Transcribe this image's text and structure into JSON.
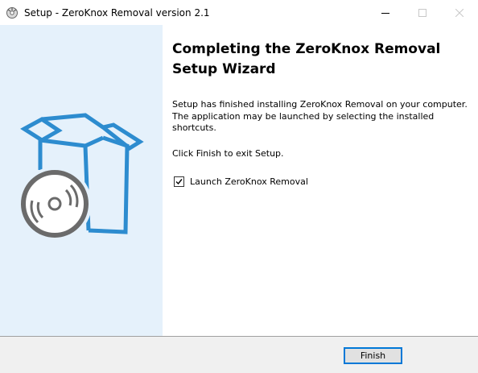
{
  "window": {
    "title": "Setup - ZeroKnox Removal version 2.1",
    "app_icon": "setup-icon",
    "controls": {
      "minimize": "minimize-icon",
      "maximize": "maximize-icon",
      "close": "close-icon"
    }
  },
  "illustration": {
    "icon": "box-with-disc-icon",
    "colors": {
      "panel_bg": "#e5f1fb",
      "box_stroke": "#2d8ccf",
      "disc_stroke": "#6b6b6b"
    }
  },
  "main": {
    "heading": "Completing the ZeroKnox Removal Setup Wizard",
    "body": "Setup has finished installing ZeroKnox Removal on your computer. The application may be launched by selecting the installed shortcuts.",
    "finish_hint": "Click Finish to exit Setup.",
    "launch_checkbox": {
      "label": "Launch ZeroKnox Removal",
      "checked": true
    }
  },
  "footer": {
    "finish_label": "Finish",
    "accent": "#0078d7"
  }
}
